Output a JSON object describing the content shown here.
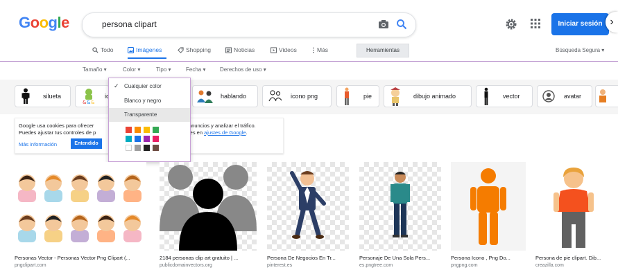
{
  "logo": {
    "letters": [
      "G",
      "o",
      "o",
      "g",
      "l",
      "e"
    ],
    "colors": [
      "#4285f4",
      "#ea4335",
      "#fbbc05",
      "#4285f4",
      "#34a853",
      "#ea4335"
    ]
  },
  "search": {
    "query": "persona clipart"
  },
  "header": {
    "signin_label": "Iniciar sesión"
  },
  "tabs": [
    {
      "label": "Todo",
      "icon": "search-icon"
    },
    {
      "label": "Imágenes",
      "icon": "image-icon",
      "active": true
    },
    {
      "label": "Shopping",
      "icon": "tag-icon"
    },
    {
      "label": "Noticias",
      "icon": "news-icon"
    },
    {
      "label": "Videos",
      "icon": "video-icon"
    },
    {
      "label": "Más",
      "icon": "more-icon"
    }
  ],
  "tools_label": "Herramientas",
  "safesearch_label": "Búsqueda Segura ▾",
  "filters": [
    {
      "label": "Tamaño ▾"
    },
    {
      "label": "Color ▾"
    },
    {
      "label": "Tipo ▾"
    },
    {
      "label": "Fecha ▾"
    },
    {
      "label": "Derechos de uso ▾"
    }
  ],
  "chips": [
    "silueta",
    "ic",
    "hablando",
    "icono png",
    "pie",
    "dibujo animado",
    "vector",
    "avatar"
  ],
  "cookie": {
    "line1": "Google usa cookies para ofrecer",
    "line2": "Puedes ajustar tus controles de p",
    "line1_right": "anuncios y analizar el tráfico.",
    "line2_right_prefix": "les en ",
    "link": "ajustes de Google",
    "line2_right_suffix": ".",
    "more_info": "Más información",
    "understood": "Entendido"
  },
  "color_menu": {
    "options": [
      "Cualquier color",
      "Blanco y negro",
      "Transparente"
    ],
    "swatches": [
      "#ea4335",
      "#fb8c00",
      "#fbbc05",
      "#34a853",
      "#00acc1",
      "#1a73e8",
      "#9c27b0",
      "#e91e63",
      "#ffffff",
      "#9e9e9e",
      "#212121",
      "#6d4c41"
    ]
  },
  "results": [
    {
      "title": "Personas Vector - Personas Vector Png Clipart (...",
      "source": "pngclipart.com"
    },
    {
      "title": "2184 personas clip art gratuito | ...",
      "source": "publicdomainvectors.org"
    },
    {
      "title": "Persona De Negocios En Tr...",
      "source": "pinterest.es"
    },
    {
      "title": "Personaje De Una Sola Pers...",
      "source": "es.pngtree.com"
    },
    {
      "title": "Persona Icono , Png Do...",
      "source": "pngpng.com"
    },
    {
      "title": "Persona de pie clipart. Dib...",
      "source": "creazilla.com"
    }
  ]
}
